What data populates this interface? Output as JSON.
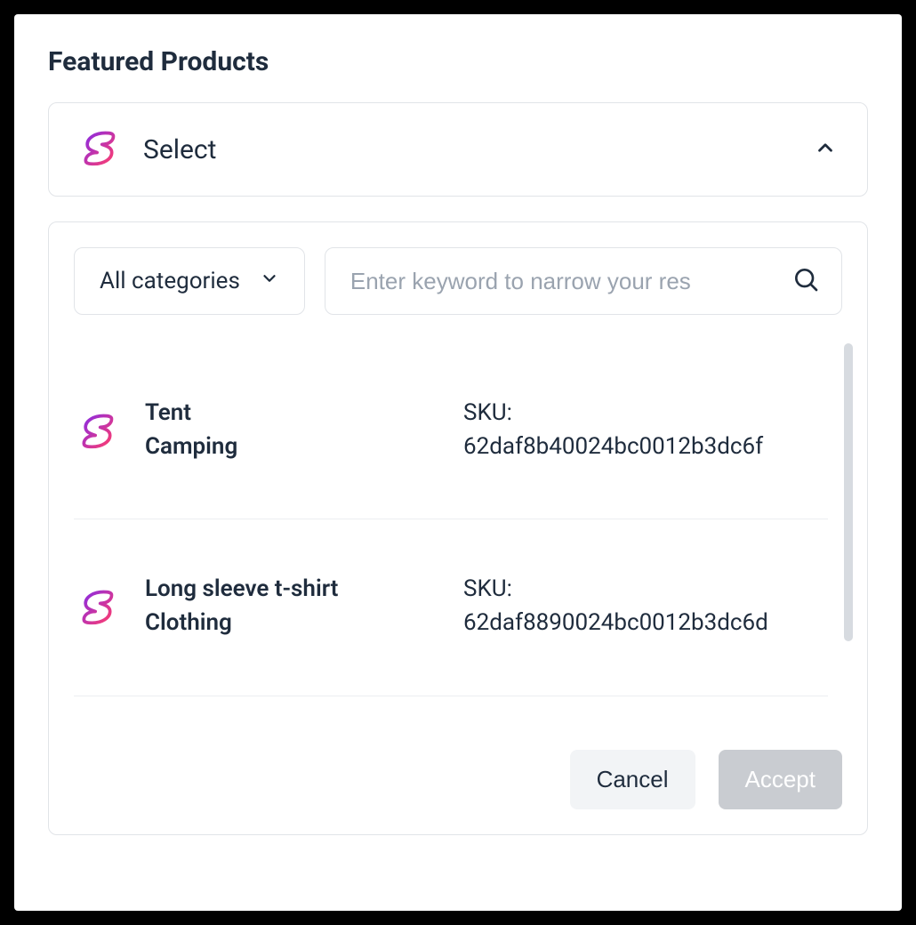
{
  "title": "Featured Products",
  "select": {
    "label": "Select"
  },
  "filters": {
    "category_label": "All categories",
    "search_placeholder": "Enter keyword to narrow your res"
  },
  "sku_prefix": "SKU:",
  "items": [
    {
      "name": "Tent",
      "category": "Camping",
      "sku": "62daf8b40024bc0012b3dc6f"
    },
    {
      "name": "Long sleeve t-shirt",
      "category": "Clothing",
      "sku": "62daf8890024bc0012b3dc6d"
    }
  ],
  "buttons": {
    "cancel": "Cancel",
    "accept": "Accept"
  }
}
